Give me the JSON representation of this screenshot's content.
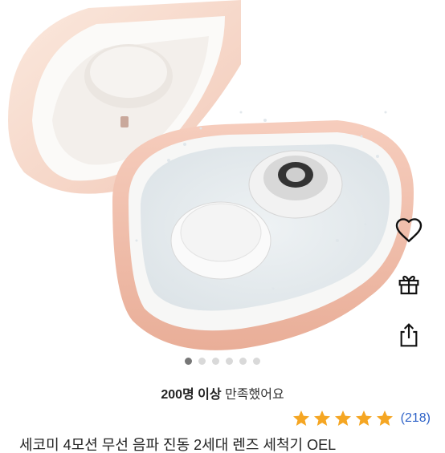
{
  "product_image": {
    "alt": "",
    "total_slides": 6,
    "active_slide": 1
  },
  "actions": {
    "favorite_icon": "heart-outline-icon",
    "gift_icon": "gift-icon",
    "share_icon": "share-icon"
  },
  "satisfaction": {
    "count_text": "200명 이상",
    "suffix_text": "만족했어요"
  },
  "rating": {
    "stars": 5,
    "star_color": "#f5a623",
    "count": "(218)",
    "count_color": "#2f63c8"
  },
  "product_title_partial": "세코미 4모션 무선 음파 진동 2세대 렌즈 세척기 OEL"
}
